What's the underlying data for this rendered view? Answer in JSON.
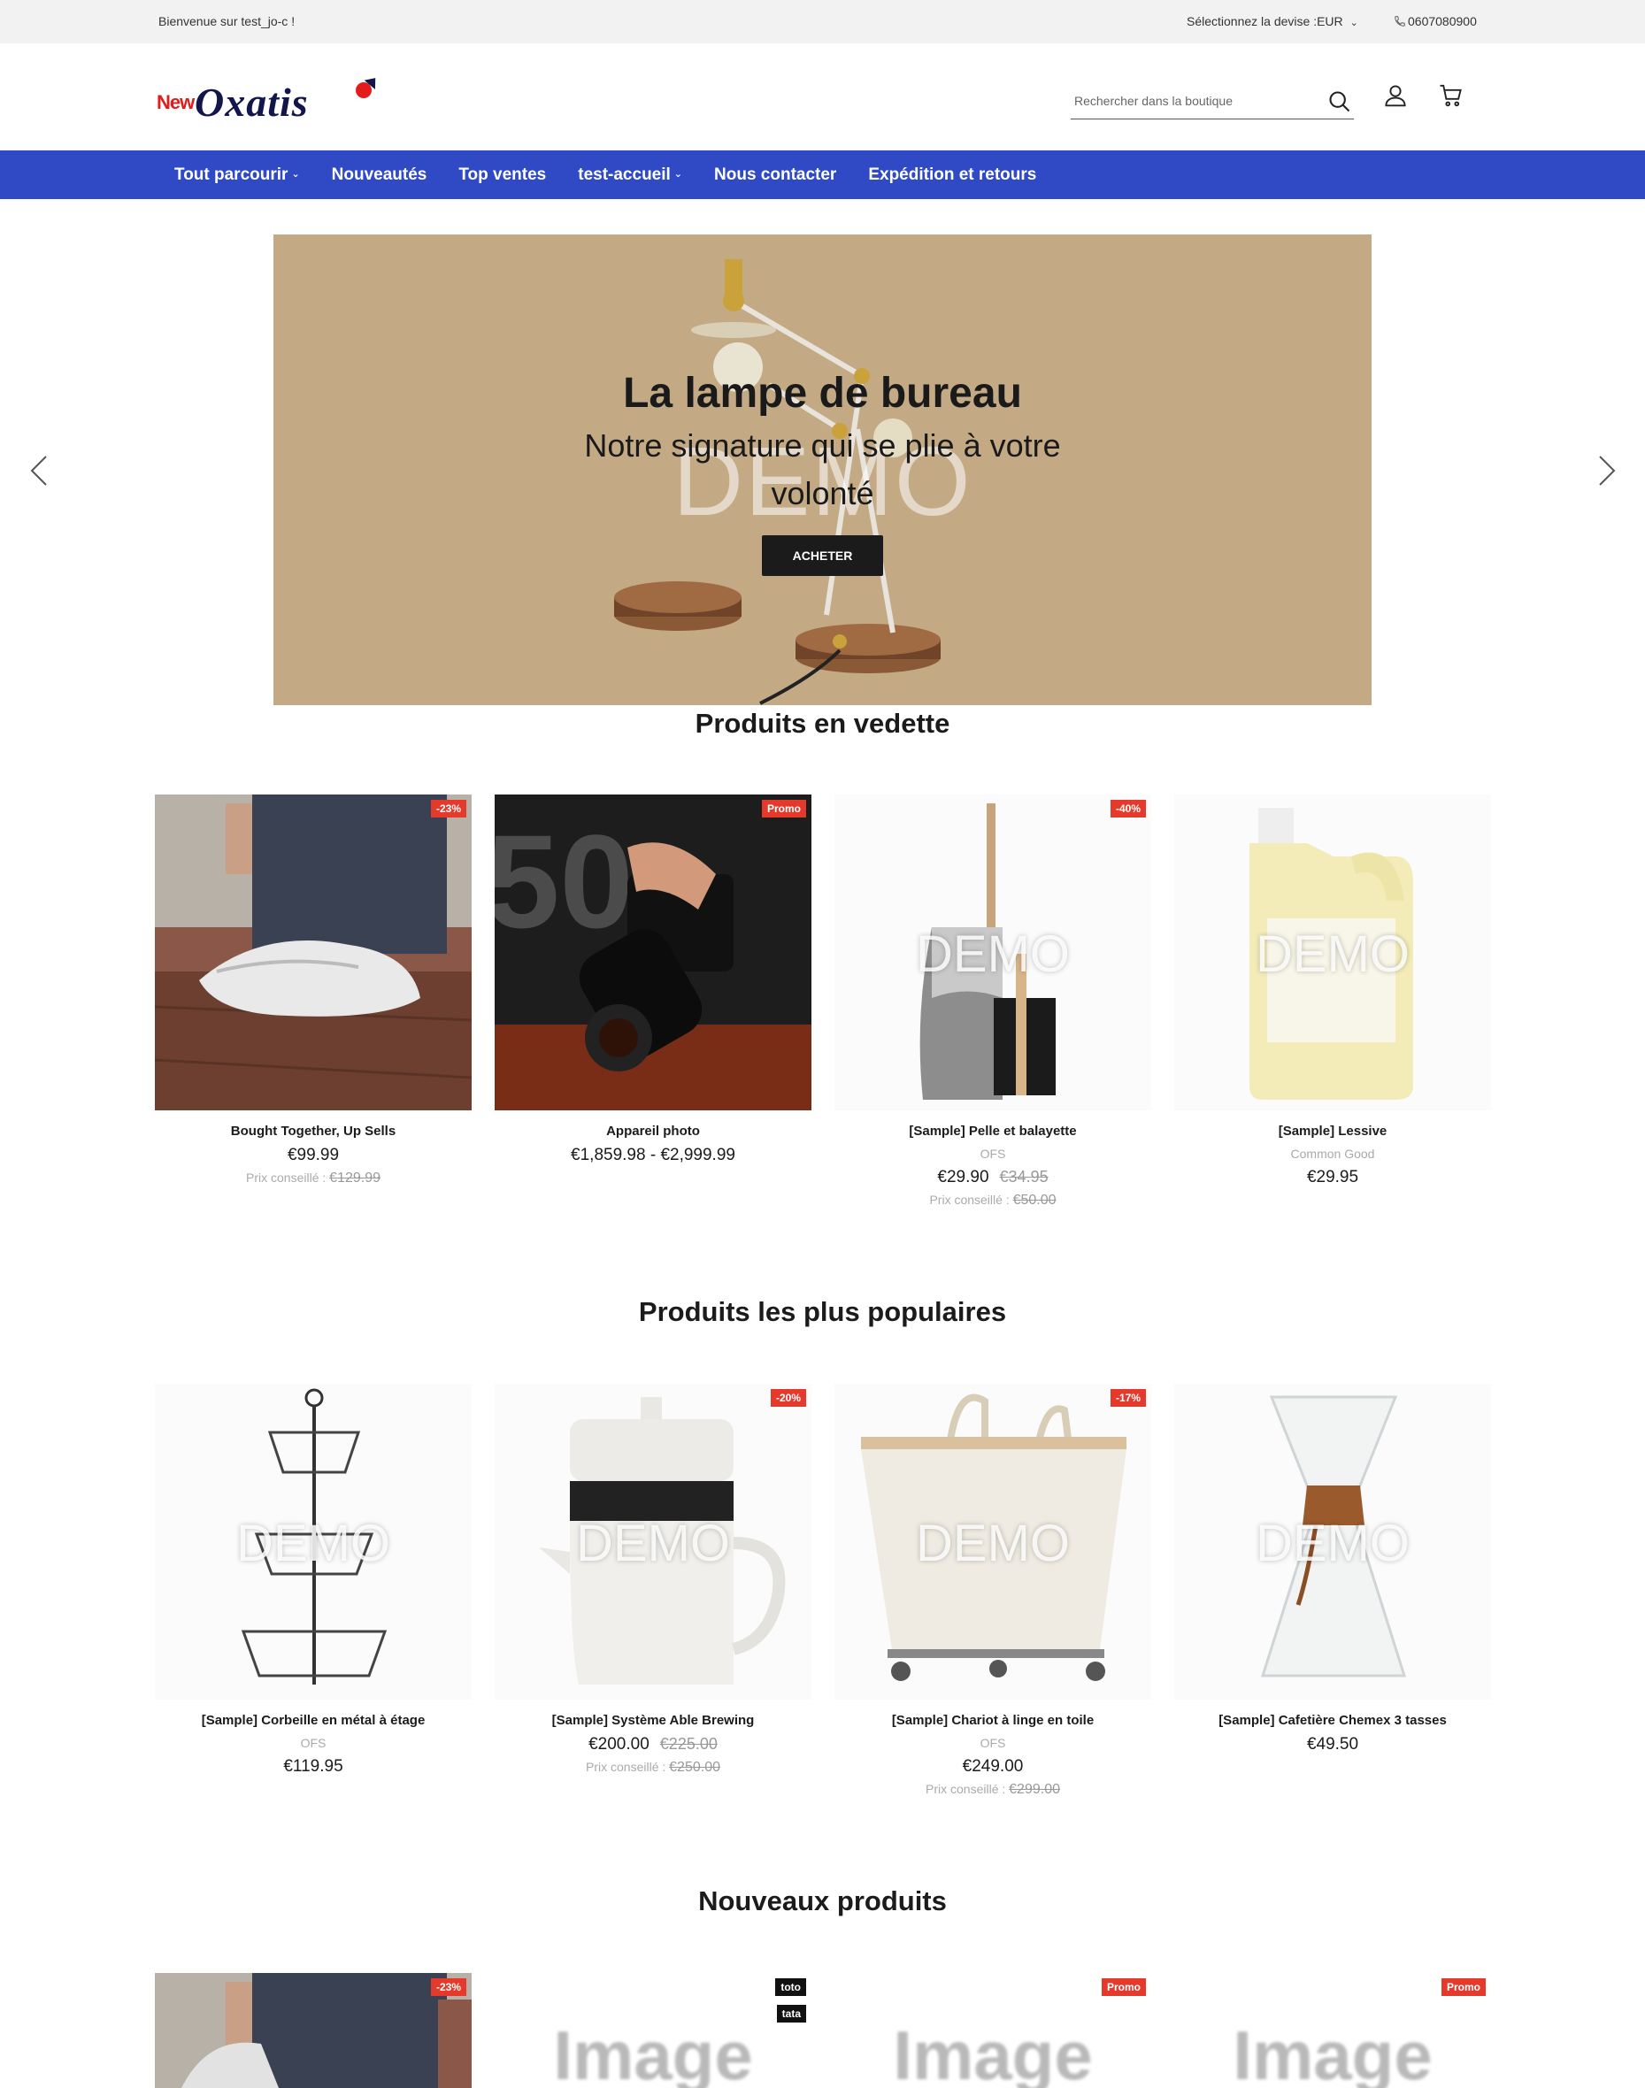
{
  "topbar": {
    "welcome": "Bienvenue sur test_jo-c !",
    "currency": "Sélectionnez la devise :EUR",
    "phone": "0607080900"
  },
  "header": {
    "logo_new": "New",
    "logo_brand": "Oxatis",
    "search_placeholder": "Rechercher dans la boutique"
  },
  "nav": {
    "items": [
      "Tout parcourir",
      "Nouveautés",
      "Top ventes",
      "test-accueil",
      "Nous contacter",
      "Expédition et retours"
    ]
  },
  "hero": {
    "title": "La lampe de bureau",
    "subtitle": "Notre signature qui se plie à votre volonté",
    "watermark": "DEMO",
    "cta": "ACHETER",
    "bg_color": "#c3aa85"
  },
  "featured": {
    "title": "Produits en vedette",
    "products": [
      {
        "name": "Bought Together, Up Sells",
        "price": "€99.99",
        "rrp_label": "Prix conseillé :",
        "rrp": "€129.99",
        "badge": "-23%"
      },
      {
        "name": "Appareil photo",
        "price": "€1,859.98 - €2,999.99",
        "badge": "Promo"
      },
      {
        "name": "[Sample] Pelle et balayette",
        "brand": "OFS",
        "price": "€29.90",
        "old_price": "€34.95",
        "rrp_label": "Prix conseillé :",
        "rrp": "€50.00",
        "badge": "-40%",
        "watermark": "DEMO"
      },
      {
        "name": "[Sample] Lessive",
        "brand": "Common Good",
        "price": "€29.95",
        "watermark": "DEMO"
      }
    ]
  },
  "popular": {
    "title": "Produits les plus populaires",
    "products": [
      {
        "name": "[Sample] Corbeille en métal à étage",
        "brand": "OFS",
        "price": "€119.95",
        "watermark": "DEMO"
      },
      {
        "name": "[Sample] Système Able Brewing",
        "price": "€200.00",
        "old_price": "€225.00",
        "rrp_label": "Prix conseillé :",
        "rrp": "€250.00",
        "badge": "-20%",
        "watermark": "DEMO"
      },
      {
        "name": "[Sample] Chariot à linge en toile",
        "brand": "OFS",
        "price": "€249.00",
        "rrp_label": "Prix conseillé :",
        "rrp": "€299.00",
        "badge": "-17%",
        "watermark": "DEMO"
      },
      {
        "name": "[Sample] Cafetière Chemex 3 tasses",
        "price": "€49.50",
        "watermark": "DEMO"
      }
    ]
  },
  "new_products": {
    "title": "Nouveaux produits",
    "products": [
      {
        "badge": "-23%"
      },
      {
        "badges": [
          "toto",
          "tata"
        ],
        "image_text": "Image"
      },
      {
        "badge": "Promo",
        "image_text": "Image"
      },
      {
        "badge": "Promo",
        "image_text": "Image"
      }
    ]
  },
  "colors": {
    "nav": "#2f4ac4",
    "badge": "#e5392b",
    "topbar": "#f2f2f2"
  }
}
